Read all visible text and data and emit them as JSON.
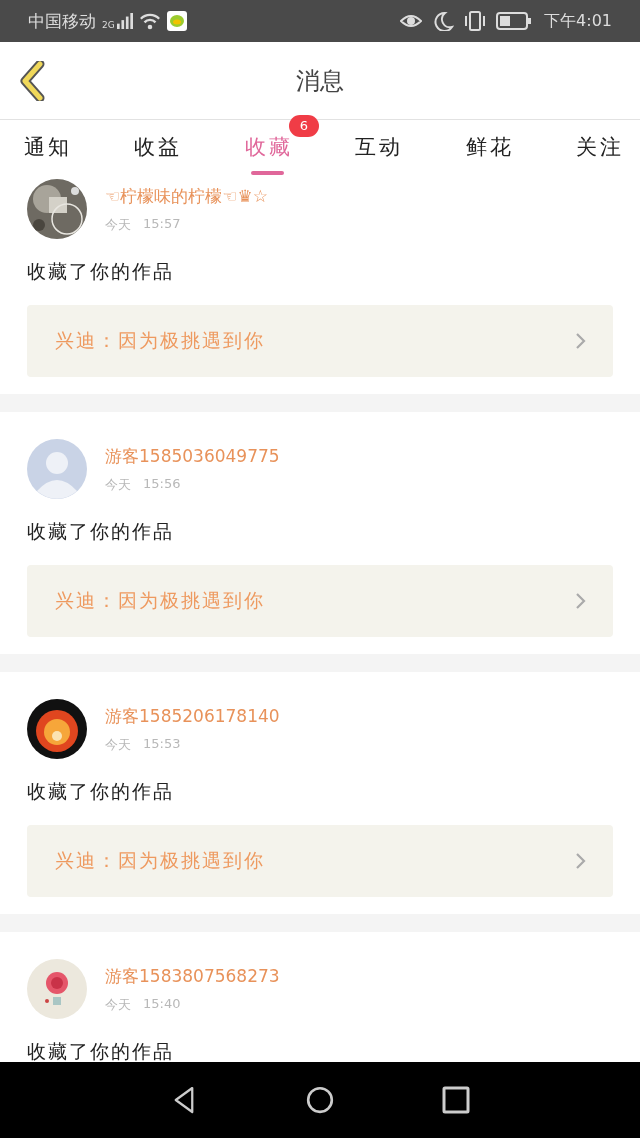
{
  "status_bar": {
    "carrier": "中国移动",
    "network": "2G",
    "time": "下午4:01"
  },
  "header": {
    "title": "消息"
  },
  "tabs": [
    {
      "label": "通知",
      "selected": false
    },
    {
      "label": "收益",
      "selected": false
    },
    {
      "label": "收藏",
      "selected": true,
      "badge": "6"
    },
    {
      "label": "互动",
      "selected": false
    },
    {
      "label": "鲜花",
      "selected": false
    },
    {
      "label": "关注",
      "selected": false
    }
  ],
  "messages": [
    {
      "name": "☜柠檬味的柠檬☜♛☆",
      "day": "今天",
      "time": "15:57",
      "action": "收藏了你的作品",
      "work": "兴迪：因为极挑遇到你"
    },
    {
      "avatar": {
        "kind": "default"
      },
      "name": "游客1585036049775",
      "day": "今天",
      "time": "15:56",
      "action": "收藏了你的作品",
      "work": "兴迪：因为极挑遇到你"
    },
    {
      "name": "游客1585206178140",
      "day": "今天",
      "time": "15:53",
      "action": "收藏了你的作品",
      "work": "兴迪：因为极挑遇到你"
    },
    {
      "name": "游客1583807568273",
      "day": "今天",
      "time": "15:40",
      "action": "收藏了你的作品"
    }
  ]
}
